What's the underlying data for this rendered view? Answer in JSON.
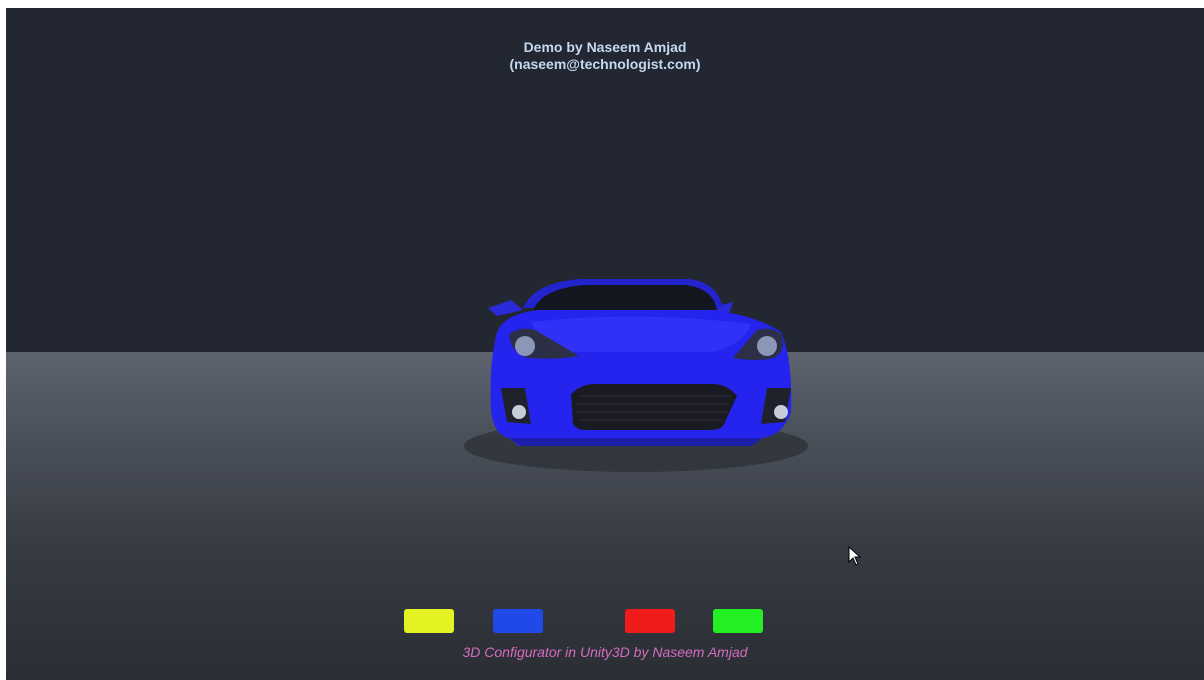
{
  "header": {
    "line1": "Demo by Naseem Amjad",
    "line2": "(naseem@technologist.com)"
  },
  "scene": {
    "car_color": "#2424ee"
  },
  "swatches": [
    {
      "color": "#e3f223"
    },
    {
      "color": "#2148e8"
    },
    {
      "color": "#f01b1b"
    },
    {
      "color": "#22f022"
    }
  ],
  "footer": {
    "text": "3D Configurator in Unity3D by Naseem Amjad"
  },
  "icons": {
    "cursor": "mouse-pointer-icon"
  }
}
